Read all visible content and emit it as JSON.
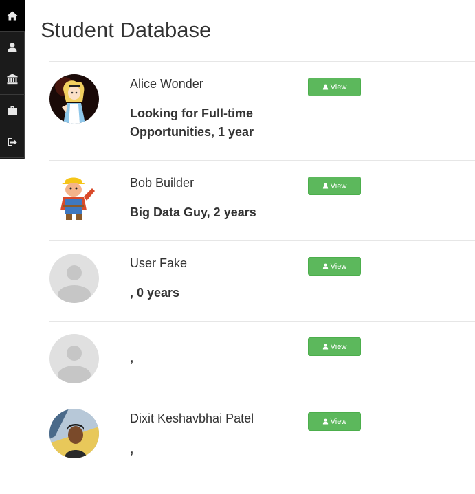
{
  "page": {
    "title": "Student Database"
  },
  "sidebar": {
    "items": [
      {
        "icon": "home-icon",
        "active": true
      },
      {
        "icon": "user-icon",
        "active": false
      },
      {
        "icon": "institution-icon",
        "active": false
      },
      {
        "icon": "briefcase-icon",
        "active": false
      },
      {
        "icon": "logout-icon",
        "active": false
      }
    ]
  },
  "students": [
    {
      "name": "Alice Wonder",
      "headline": "Looking for Full-time Opportunities, 1 year",
      "view_label": "View",
      "avatar": "alice-avatar"
    },
    {
      "name": "Bob Builder",
      "headline": "Big Data Guy, 2 years",
      "view_label": "View",
      "avatar": "bob-avatar"
    },
    {
      "name": "User Fake",
      "headline": ", 0 years",
      "view_label": "View",
      "avatar": "default-avatar"
    },
    {
      "name": "",
      "headline": ",",
      "view_label": "View",
      "avatar": "default-avatar"
    },
    {
      "name": "Dixit Keshavbhai Patel",
      "headline": ",",
      "view_label": "View",
      "avatar": "photo-avatar"
    }
  ],
  "colors": {
    "sidebar_bg": "#1b1b1b",
    "button_green": "#5cb85c",
    "divider": "#e6e6e6"
  }
}
